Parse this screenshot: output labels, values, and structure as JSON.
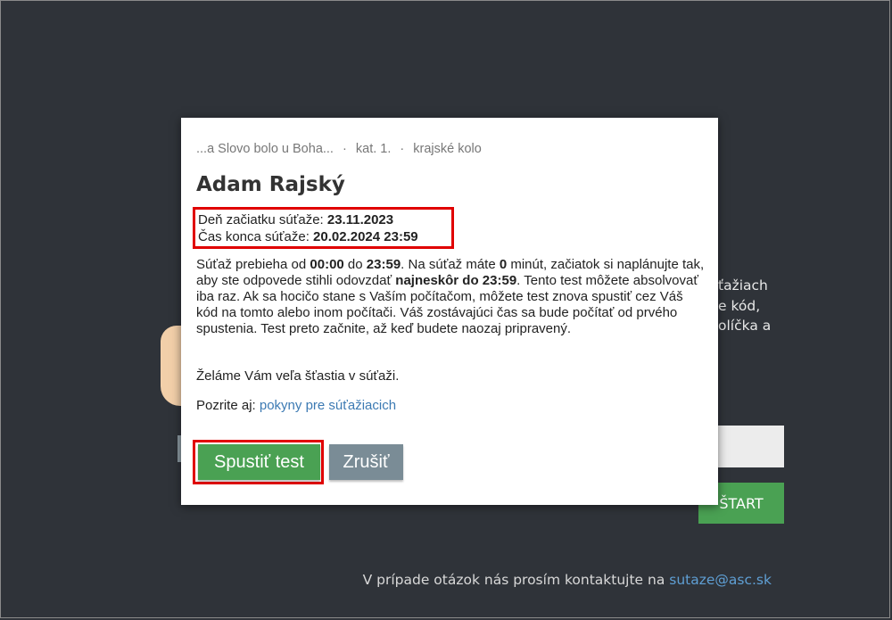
{
  "background": {
    "text_lines": [
      "ťažiach",
      "e kód,",
      "olíčka a"
    ],
    "start_button_label": "ŠTART",
    "footer_text": "V prípade otázok nás prosím kontaktujte na",
    "footer_email": "sutaze@asc.sk"
  },
  "modal": {
    "breadcrumb": {
      "competition": "...a Slovo bolo u Boha...",
      "category": "kat. 1.",
      "round": "krajské kolo",
      "separator": "·"
    },
    "participant_name": "Adam Rajský",
    "start_date_label": "Deň začiatku súťaže:",
    "start_date_value": "23.11.2023",
    "end_time_label": "Čas konca súťaže:",
    "end_time_value": "20.02.2024 23:59",
    "paragraph": {
      "t1": "Súťaž prebieha od ",
      "from": "00:00",
      "t2": " do ",
      "to": "23:59",
      "t3": ". Na súťaž máte ",
      "minutes": "0",
      "t4": " minút, začiatok si naplánujte tak, aby ste odpovede stihli odovzdať ",
      "deadline": "najneskôr do 23:59",
      "t5": ". Tento test môžete absolvovať iba raz. Ak sa hocičo stane s Vaším počítačom, môžete test znova spustiť cez Váš kód na tomto alebo inom počítači. Váš zostávajúci čas sa bude počítať od prvého spustenia. Test preto začnite, až keď budete naozaj pripravený."
    },
    "wish_text": "Želáme Vám veľa šťastia v súťaži.",
    "see_also_label": "Pozrite aj:",
    "see_also_link": "pokyny pre súťažiacich",
    "start_button": "Spustiť test",
    "cancel_button": "Zrušiť"
  },
  "colors": {
    "background": "#2f3339",
    "primary_button": "#4aa153",
    "secondary_button": "#7a8c96",
    "highlight_border": "#e00000",
    "link": "#3c7ab3"
  }
}
